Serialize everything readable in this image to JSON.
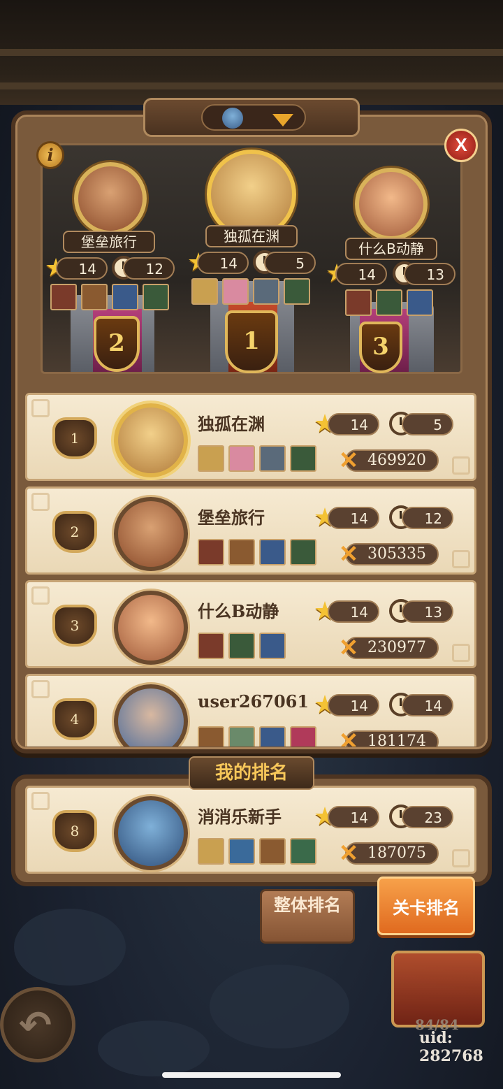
{
  "podium": {
    "first": {
      "rank": "1",
      "name": "独孤在渊",
      "stars": "14",
      "time": "5"
    },
    "second": {
      "rank": "2",
      "name": "堡垒旅行",
      "stars": "14",
      "time": "12"
    },
    "third": {
      "rank": "3",
      "name": "什么B动静",
      "stars": "14",
      "time": "13"
    }
  },
  "ranking_list": [
    {
      "rank": "1",
      "name": "独孤在渊",
      "stars": "14",
      "time": "5",
      "score": "469920"
    },
    {
      "rank": "2",
      "name": "堡垒旅行",
      "stars": "14",
      "time": "12",
      "score": "305335"
    },
    {
      "rank": "3",
      "name": "什么B动静",
      "stars": "14",
      "time": "13",
      "score": "230977"
    },
    {
      "rank": "4",
      "name": "user267061",
      "stars": "14",
      "time": "14",
      "score": "181174"
    }
  ],
  "my_rank": {
    "title": "我的排名",
    "rank": "8",
    "name": "消消乐新手",
    "stars": "14",
    "time": "23",
    "score": "187075"
  },
  "tabs": {
    "overall": "整体排名",
    "stage": "关卡排名"
  },
  "buttons": {
    "info": "i",
    "close": "X",
    "back": "↶"
  },
  "footer": {
    "progress": "84/84",
    "uid": "uid: 282768"
  },
  "colors": {
    "accent": "#f0a030",
    "panel": "#7a5a3c",
    "row": "#f6ead2",
    "stage_tab": "#f7a14a"
  }
}
